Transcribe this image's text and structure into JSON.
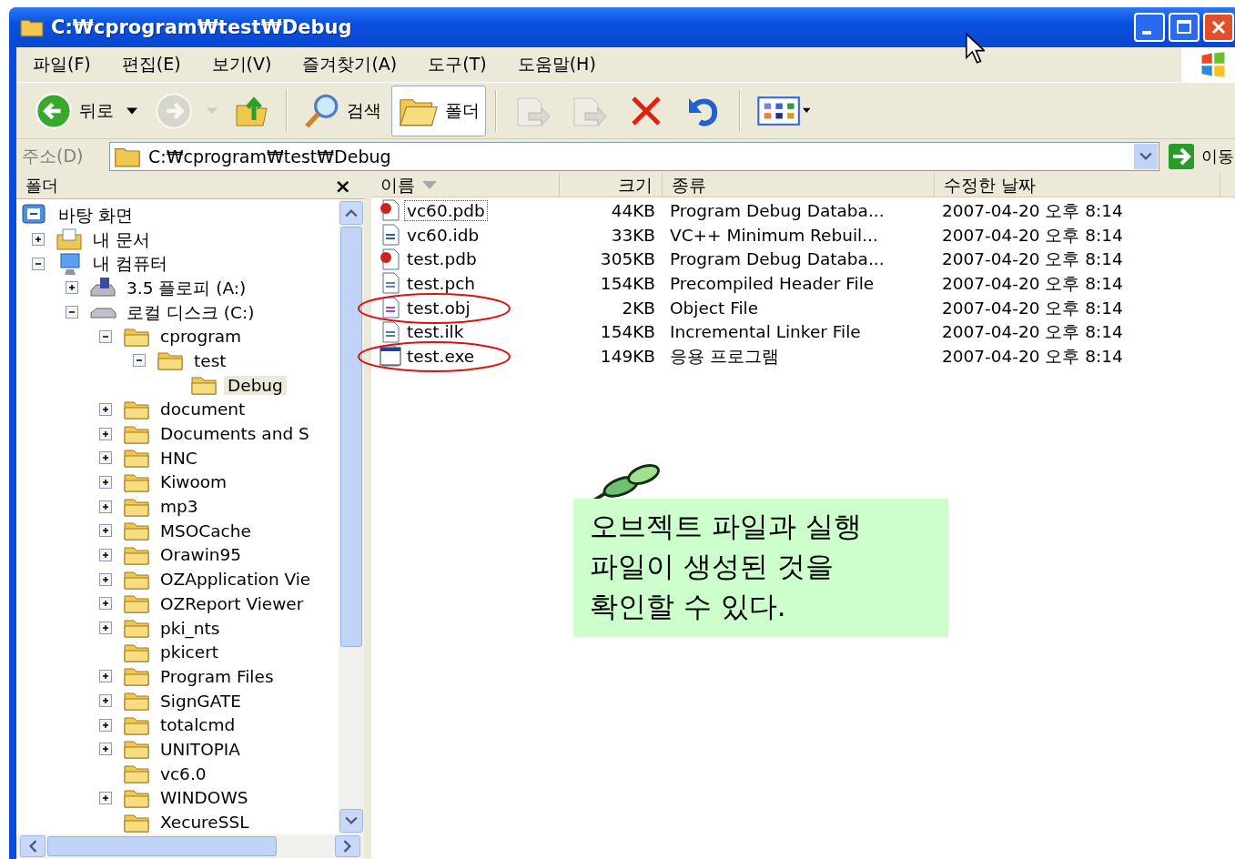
{
  "window": {
    "title": "C:₩cprogram₩test₩Debug"
  },
  "menu": [
    "파일(F)",
    "편집(E)",
    "보기(V)",
    "즐겨찾기(A)",
    "도구(T)",
    "도움말(H)"
  ],
  "toolbar": [
    {
      "kind": "back",
      "label": "뒤로",
      "disabled": false,
      "pressed": false
    },
    {
      "kind": "forward",
      "disabled": true,
      "pressed": false
    },
    {
      "kind": "up",
      "disabled": false,
      "pressed": false
    },
    {
      "kind": "separator"
    },
    {
      "kind": "search",
      "label": "검색",
      "disabled": false,
      "pressed": false
    },
    {
      "kind": "folders",
      "label": "폴더",
      "disabled": false,
      "pressed": true
    },
    {
      "kind": "separator"
    },
    {
      "kind": "move",
      "disabled": true,
      "pressed": false
    },
    {
      "kind": "copy",
      "disabled": true,
      "pressed": false
    },
    {
      "kind": "delete",
      "disabled": false,
      "pressed": false
    },
    {
      "kind": "undo",
      "disabled": false,
      "pressed": false
    },
    {
      "kind": "separator"
    },
    {
      "kind": "views",
      "disabled": false,
      "pressed": false
    }
  ],
  "address": {
    "label": "주소(D)",
    "value": "C:₩cprogram₩test₩Debug",
    "go_label": "이동"
  },
  "folder_pane": {
    "title": "폴더",
    "close": "×",
    "tree": [
      {
        "label": "바탕 화면",
        "kind": "desktop",
        "selected": false,
        "children": [
          {
            "label": "내 문서",
            "kind": "documents",
            "expanded": false,
            "selected": false
          },
          {
            "label": "내 컴퓨터",
            "kind": "computer",
            "expanded": true,
            "selected": false,
            "children": [
              {
                "label": "3.5 플로피 (A:)",
                "kind": "floppy",
                "expanded": false,
                "selected": false
              },
              {
                "label": "로컬 디스크 (C:)",
                "kind": "drive",
                "expanded": true,
                "selected": false,
                "children": [
                  {
                    "label": "cprogram",
                    "kind": "folder",
                    "expanded": true,
                    "selected": false,
                    "children": [
                      {
                        "label": "test",
                        "kind": "folder",
                        "expanded": true,
                        "selected": false,
                        "children": [
                          {
                            "label": "Debug",
                            "kind": "folder",
                            "selected": true
                          }
                        ]
                      }
                    ]
                  },
                  {
                    "label": "document",
                    "kind": "folder",
                    "expanded": false,
                    "selected": false
                  },
                  {
                    "label": "Documents and S",
                    "kind": "folder",
                    "expanded": false,
                    "selected": false
                  },
                  {
                    "label": "HNC",
                    "kind": "folder",
                    "expanded": false,
                    "selected": false
                  },
                  {
                    "label": "Kiwoom",
                    "kind": "folder",
                    "expanded": false,
                    "selected": false
                  },
                  {
                    "label": "mp3",
                    "kind": "folder",
                    "expanded": false,
                    "selected": false
                  },
                  {
                    "label": "MSOCache",
                    "kind": "folder",
                    "expanded": false,
                    "selected": false
                  },
                  {
                    "label": "Orawin95",
                    "kind": "folder",
                    "expanded": false,
                    "selected": false
                  },
                  {
                    "label": "OZApplication Vie",
                    "kind": "folder",
                    "expanded": false,
                    "selected": false
                  },
                  {
                    "label": "OZReport Viewer",
                    "kind": "folder",
                    "expanded": false,
                    "selected": false
                  },
                  {
                    "label": "pki_nts",
                    "kind": "folder",
                    "expanded": false,
                    "selected": false
                  },
                  {
                    "label": "pkicert",
                    "kind": "folder",
                    "selected": false
                  },
                  {
                    "label": "Program Files",
                    "kind": "folder",
                    "expanded": false,
                    "selected": false
                  },
                  {
                    "label": "SignGATE",
                    "kind": "folder",
                    "expanded": false,
                    "selected": false
                  },
                  {
                    "label": "totalcmd",
                    "kind": "folder",
                    "expanded": false,
                    "selected": false
                  },
                  {
                    "label": "UNITOPIA",
                    "kind": "folder",
                    "expanded": false,
                    "selected": false
                  },
                  {
                    "label": "vc6.0",
                    "kind": "folder",
                    "selected": false
                  },
                  {
                    "label": "WINDOWS",
                    "kind": "folder",
                    "expanded": false,
                    "selected": false
                  },
                  {
                    "label": "XecureSSL",
                    "kind": "folder",
                    "selected": false
                  }
                ]
              }
            ]
          }
        ]
      }
    ]
  },
  "files": {
    "columns": [
      {
        "label": "이름",
        "sorted": true
      },
      {
        "label": "크기",
        "sorted": false
      },
      {
        "label": "종류",
        "sorted": false
      },
      {
        "label": "수정한 날짜",
        "sorted": false
      }
    ],
    "rows": [
      {
        "name": "vc60.pdb",
        "size": "44KB",
        "type": "Program Debug Databa...",
        "modified": "2007-04-20 오후 8:14",
        "kind": "pdb",
        "focused": true,
        "circled": false
      },
      {
        "name": "vc60.idb",
        "size": "33KB",
        "type": "VC++ Minimum Rebuil...",
        "modified": "2007-04-20 오후 8:14",
        "kind": "idb",
        "focused": false,
        "circled": false
      },
      {
        "name": "test.pdb",
        "size": "305KB",
        "type": "Program Debug Databa...",
        "modified": "2007-04-20 오후 8:14",
        "kind": "pdb",
        "focused": false,
        "circled": false
      },
      {
        "name": "test.pch",
        "size": "154KB",
        "type": "Precompiled Header File",
        "modified": "2007-04-20 오후 8:14",
        "kind": "pch",
        "focused": false,
        "circled": false
      },
      {
        "name": "test.obj",
        "size": "2KB",
        "type": "Object File",
        "modified": "2007-04-20 오후 8:14",
        "kind": "obj",
        "focused": false,
        "circled": true
      },
      {
        "name": "test.ilk",
        "size": "154KB",
        "type": "Incremental Linker File",
        "modified": "2007-04-20 오후 8:14",
        "kind": "ilk",
        "focused": false,
        "circled": false
      },
      {
        "name": "test.exe",
        "size": "149KB",
        "type": "응용 프로그램",
        "modified": "2007-04-20 오후 8:14",
        "kind": "exe",
        "focused": false,
        "circled": true
      }
    ]
  },
  "note": {
    "text": "오브젝트 파일과 실행 파일이 생성된 것을 확인할 수 있다."
  }
}
